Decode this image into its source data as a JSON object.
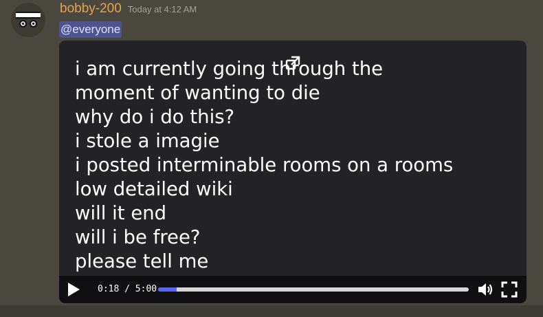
{
  "message": {
    "author": "bobby-200",
    "timestamp": "Today at 4:12 AM",
    "mention": "@everyone",
    "colors": {
      "author": "#e6a34a",
      "mention_bg": "#4e5391",
      "progress": "#5865f2"
    }
  },
  "video": {
    "lines": [
      "i am currently going through the",
      "moment of wanting to die",
      "why do i do this?",
      "i stole a imagie",
      "i posted interminable rooms on a rooms",
      "low detailed wiki",
      "will it end",
      "will i be free?",
      "please tell me"
    ],
    "time_display": "0:18 / 5:00",
    "progress_fraction": 0.06,
    "icons": {
      "external": "external-link-icon",
      "play": "play-icon",
      "volume": "volume-icon",
      "fullscreen": "fullscreen-icon"
    }
  }
}
